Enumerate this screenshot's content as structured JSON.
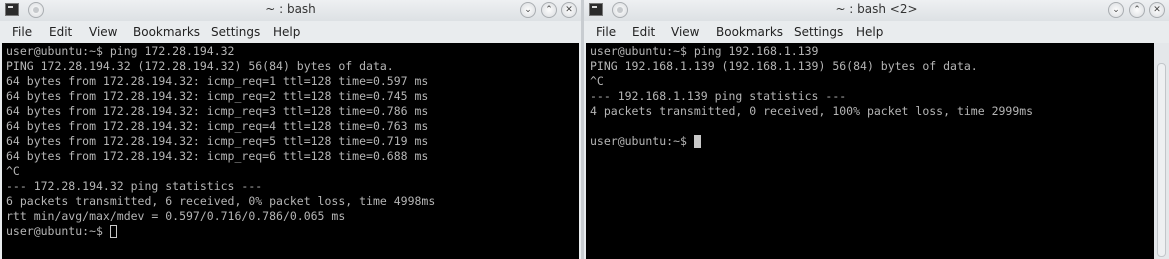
{
  "left_window": {
    "title": "~ : bash",
    "menu": [
      "File",
      "Edit",
      "View",
      "Bookmarks",
      "Settings",
      "Help"
    ],
    "lines": [
      "user@ubuntu:~$ ping 172.28.194.32",
      "PING 172.28.194.32 (172.28.194.32) 56(84) bytes of data.",
      "64 bytes from 172.28.194.32: icmp_req=1 ttl=128 time=0.597 ms",
      "64 bytes from 172.28.194.32: icmp_req=2 ttl=128 time=0.745 ms",
      "64 bytes from 172.28.194.32: icmp_req=3 ttl=128 time=0.786 ms",
      "64 bytes from 172.28.194.32: icmp_req=4 ttl=128 time=0.763 ms",
      "64 bytes from 172.28.194.32: icmp_req=5 ttl=128 time=0.719 ms",
      "64 bytes from 172.28.194.32: icmp_req=6 ttl=128 time=0.688 ms",
      "^C",
      "--- 172.28.194.32 ping statistics ---",
      "6 packets transmitted, 6 received, 0% packet loss, time 4998ms",
      "rtt min/avg/max/mdev = 0.597/0.716/0.786/0.065 ms",
      "user@ubuntu:~$ "
    ]
  },
  "right_window": {
    "title": "~ : bash <2>",
    "menu": [
      "File",
      "Edit",
      "View",
      "Bookmarks",
      "Settings",
      "Help"
    ],
    "lines": [
      "user@ubuntu:~$ ping 192.168.1.139",
      "PING 192.168.1.139 (192.168.1.139) 56(84) bytes of data.",
      "^C",
      "--- 192.168.1.139 ping statistics ---",
      "4 packets transmitted, 0 received, 100% packet loss, time 2999ms",
      "",
      "user@ubuntu:~$ "
    ]
  },
  "colors": {
    "terminal_bg": "#000000",
    "terminal_fg": "#b5b5b5",
    "chrome": "#e9ecee"
  },
  "icons": [
    "terminal-app-icon",
    "pin-icon",
    "minimize-icon",
    "maximize-icon",
    "close-icon"
  ]
}
